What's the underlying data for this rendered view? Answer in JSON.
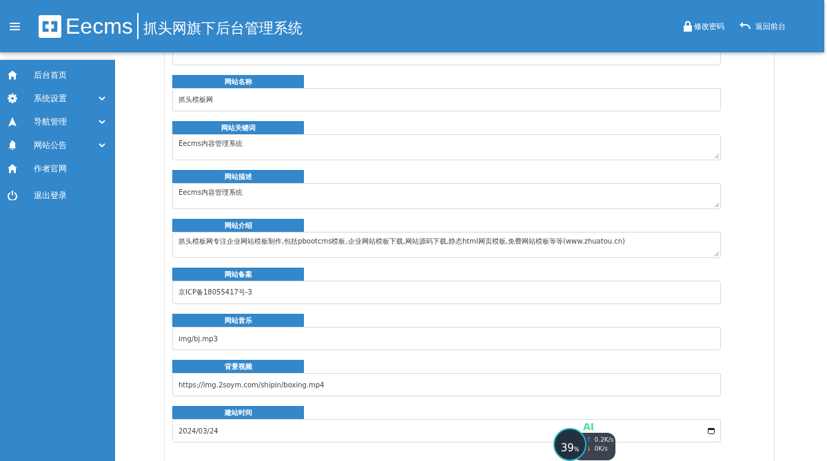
{
  "header": {
    "logo_text": "Eecms",
    "system_title": "抓头网旗下后台管理系统",
    "actions": [
      {
        "kind": "lock",
        "label": "修改密码"
      },
      {
        "kind": "undo",
        "label": "返回前台"
      }
    ]
  },
  "sidebar": {
    "items": [
      {
        "kind": "home",
        "label": "后台首页",
        "expandable": false
      },
      {
        "kind": "gear",
        "label": "系统设置",
        "expandable": true
      },
      {
        "kind": "navigation",
        "label": "导航管理",
        "expandable": true
      },
      {
        "kind": "bell",
        "label": "网站公告",
        "expandable": true
      },
      {
        "kind": "home",
        "label": "作者官网",
        "expandable": false
      },
      {
        "kind": "power",
        "label": "退出登录",
        "expandable": false
      }
    ]
  },
  "form": {
    "fields": [
      {
        "kind": "partial"
      },
      {
        "kind": "input",
        "label": "网站名称",
        "value": "抓头模板网"
      },
      {
        "kind": "textarea",
        "label": "网站关键词",
        "value": "Eecms内容管理系统"
      },
      {
        "kind": "textarea",
        "label": "网站描述",
        "value": "Eecms内容管理系统"
      },
      {
        "kind": "textarea",
        "label": "网站介绍",
        "value": "抓头模板网专注企业网站模板制作,包括pbootcms模板,企业网站模板下载,网站源码下载,静态html网页模板,免费网站模板等等(www.zhuatou.cn)"
      },
      {
        "kind": "input",
        "label": "网站备案",
        "value": "京ICP备18055417号-3"
      },
      {
        "kind": "input",
        "label": "网站音乐",
        "value": "img/bj.mp3"
      },
      {
        "kind": "input",
        "label": "背景视频",
        "value": "https://img.2soym.com/shipin/boxing.mp4"
      },
      {
        "kind": "date",
        "label": "建站时间",
        "value": "2024/03/24"
      }
    ]
  },
  "monitor_widget": {
    "badge": "AI",
    "percent": "39",
    "percent_unit": "%",
    "upload_arrow": "↑",
    "upload": "0.2K/s",
    "download_arrow": "↓",
    "download": "0K/s"
  }
}
